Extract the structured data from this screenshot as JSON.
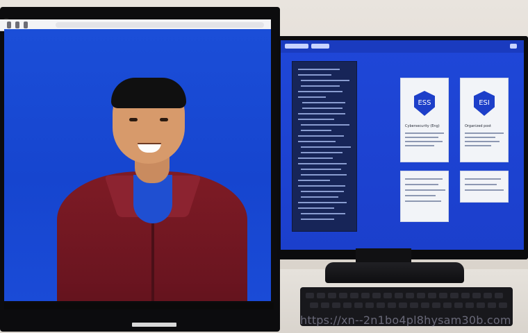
{
  "scene": {
    "description": "",
    "watermark_text": "https://xn--2n1bo4pl8hysam30b.com",
    "colors": {
      "wall": "#e9e4de",
      "screen_blue": "#1b4ed8",
      "jacket": "#7e1b25"
    }
  },
  "right_screen": {
    "card_1": {
      "badge_text": "ESS",
      "title": "Cybersecurity (Eng)"
    },
    "card_2": {
      "badge_text": "ESI",
      "title": "Organized post"
    }
  },
  "icons": {
    "left_monitor": "monitor-icon",
    "right_monitor": "monitor-icon",
    "keyboard": "keyboard-icon",
    "badge": "shield-icon"
  }
}
